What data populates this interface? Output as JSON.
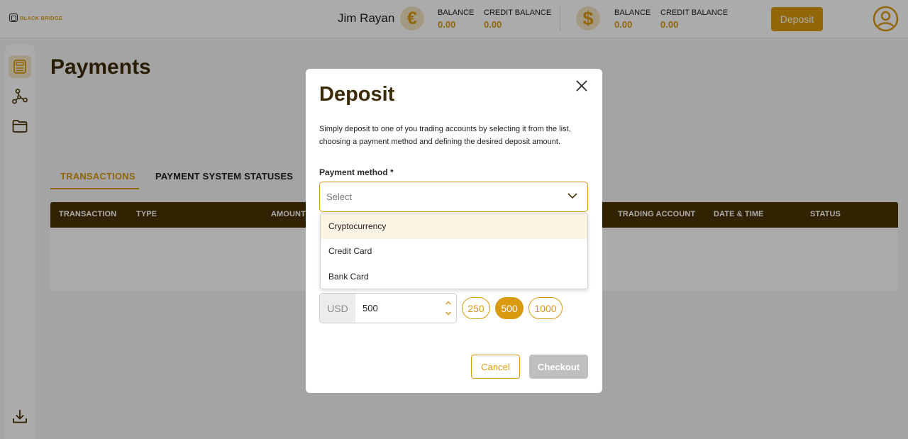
{
  "header": {
    "logo_text": "BLACK BRIDGE",
    "user_name": "Jim Rayan",
    "eur_symbol": "€",
    "usd_symbol": "$",
    "eur": {
      "balance_label": "BALANCE",
      "balance_value": "0.00",
      "credit_label": "CREDIT BALANCE",
      "credit_value": "0.00"
    },
    "usd": {
      "balance_label": "BALANCE",
      "balance_value": "0.00",
      "credit_label": "CREDIT BALANCE",
      "credit_value": "0.00"
    },
    "deposit_label": "Deposit"
  },
  "sidebar": {
    "items": [
      {
        "icon": "calculator-icon",
        "active": true
      },
      {
        "icon": "network-icon",
        "active": false
      },
      {
        "icon": "folder-icon",
        "active": false
      }
    ],
    "bottom_icon": "download-icon"
  },
  "main": {
    "title": "Payments",
    "tabs": [
      {
        "label": "TRANSACTIONS",
        "active": true
      },
      {
        "label": "PAYMENT SYSTEM STATUSES",
        "active": false
      }
    ],
    "table_columns": [
      "TRANSACTION",
      "TYPE",
      "AMOUNT",
      "TRADING ACCOUNT",
      "DATE & TIME",
      "STATUS"
    ]
  },
  "modal": {
    "title": "Deposit",
    "description": "Simply deposit to one of you trading accounts by selecting it from the list, choosing a payment method and defining the desired deposit amount.",
    "payment_method_label": "Payment method *",
    "select_placeholder": "Select",
    "options": [
      "Cryptocurrency",
      "Credit Card",
      "Bank Card"
    ],
    "amount_currency": "USD",
    "amount_value": "500",
    "presets": [
      "250",
      "500",
      "1000"
    ],
    "selected_preset": "500",
    "cancel_label": "Cancel",
    "checkout_label": "Checkout"
  },
  "colors": {
    "accent": "#d99a10",
    "table_header": "#4a3304",
    "title": "#3d2b05"
  }
}
